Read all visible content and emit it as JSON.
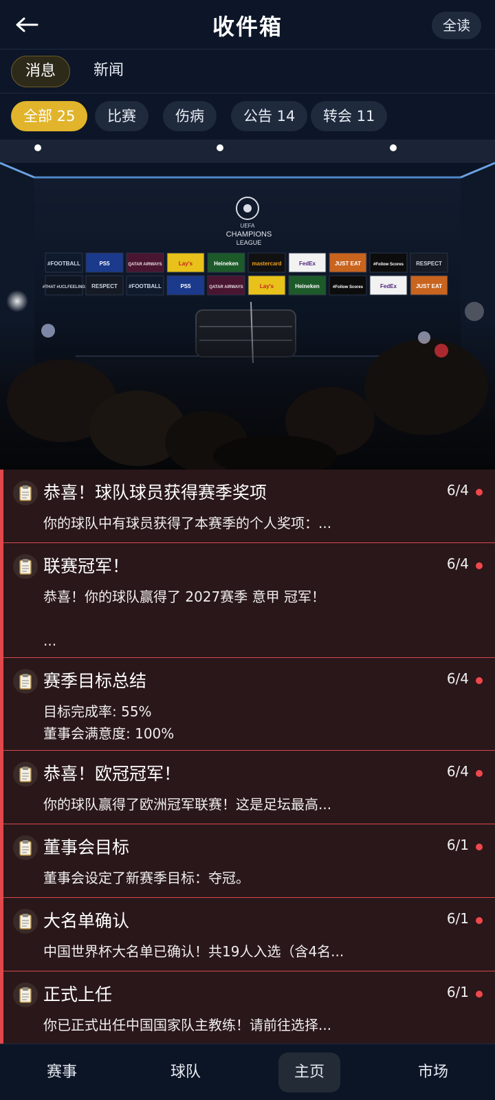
{
  "header": {
    "title": "收件箱",
    "read_all_label": "全读"
  },
  "main_tabs": [
    {
      "label": "消息",
      "active": true
    },
    {
      "label": "新闻",
      "active": false
    }
  ],
  "filters": [
    {
      "label": "全部 25",
      "active": true
    },
    {
      "label": "比赛",
      "active": false
    },
    {
      "label": "伤病",
      "active": false
    },
    {
      "label": "公告 14",
      "active": false
    },
    {
      "label": "转会 11",
      "active": false
    }
  ],
  "banner": {
    "logo_lines": [
      "CHAMPIONS",
      "LEAGUE"
    ],
    "uefa_label": "UEFA",
    "sponsors_row1": [
      "#FOOTBALL",
      "PS5",
      "QATAR AIRWAYS",
      "Lay's",
      "Heineken",
      "mastercard",
      "FedEx",
      "JUST EAT",
      "#Follow Scores",
      "RESPECT"
    ],
    "sponsors_row2": [
      "#THAT #UCLFEELING",
      "RESPECT",
      "#FOOTBALL",
      "PS5",
      "QATAR AIRWAYS",
      "Lay's",
      "Heineken",
      "#Follow Scores",
      "FedEx",
      "JUST EAT"
    ]
  },
  "messages": [
    {
      "title": "恭喜！球队球员获得赛季奖项",
      "date": "6/4",
      "body": "你的球队中有球员获得了本赛季的个人奖项：..."
    },
    {
      "title": "联赛冠军！",
      "date": "6/4",
      "body": "恭喜！你的球队赢得了 2027赛季 意甲 冠军！\n\n..."
    },
    {
      "title": "赛季目标总结",
      "date": "6/4",
      "body": "目标完成率: 55%\n董事会满意度: 100%"
    },
    {
      "title": "恭喜！欧冠冠军！",
      "date": "6/4",
      "body": "你的球队赢得了欧洲冠军联赛！这是足坛最高..."
    },
    {
      "title": "董事会目标",
      "date": "6/1",
      "body": "董事会设定了新赛季目标：夺冠。"
    },
    {
      "title": "大名单确认",
      "date": "6/1",
      "body": "中国世界杯大名单已确认！共19人入选（含4名..."
    },
    {
      "title": "正式上任",
      "date": "6/1",
      "body": "你已正式出任中国国家队主教练！请前往选择..."
    }
  ],
  "bottom_nav": [
    {
      "label": "赛事",
      "active": false
    },
    {
      "label": "球队",
      "active": false
    },
    {
      "label": "主页",
      "active": true
    },
    {
      "label": "市场",
      "active": false
    }
  ],
  "colors": {
    "background": "#0c1526",
    "accent_gold": "#e1b42b",
    "unread_red": "#f0474b",
    "message_bg": "#2a171a"
  }
}
